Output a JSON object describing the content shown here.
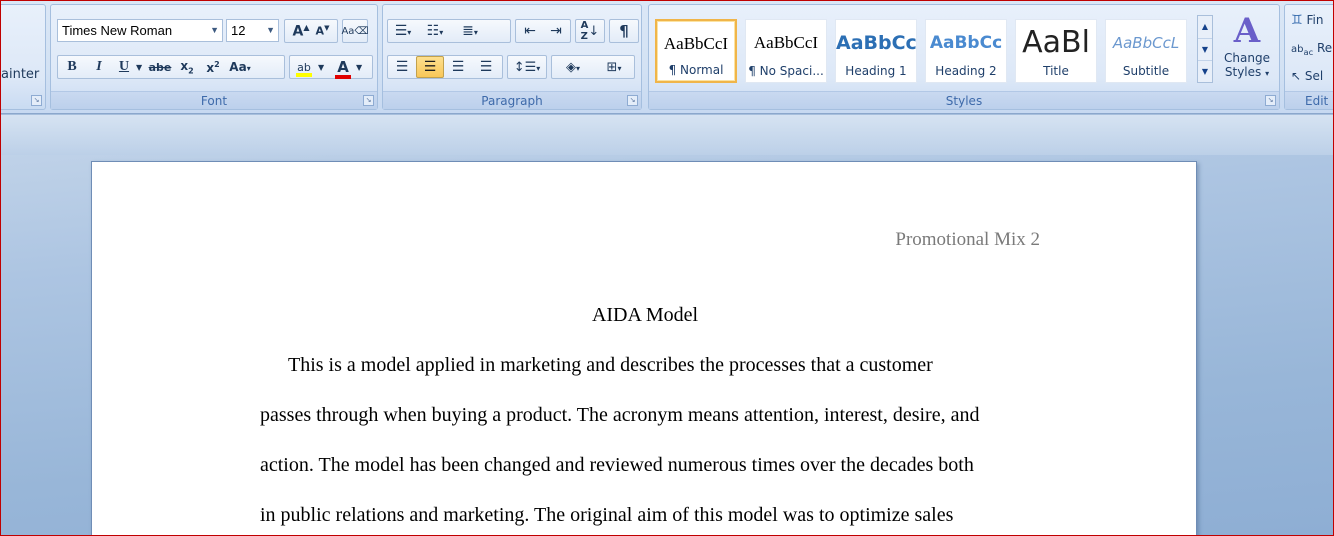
{
  "clipboard": {
    "painter_label": "ainter"
  },
  "font": {
    "group_label": "Font",
    "name": "Times New Roman",
    "size": "12"
  },
  "paragraph": {
    "group_label": "Paragraph"
  },
  "styles": {
    "group_label": "Styles",
    "items": [
      {
        "sample": "AaBbCcI",
        "name": "¶ Normal"
      },
      {
        "sample": "AaBbCcI",
        "name": "¶ No Spaci..."
      },
      {
        "sample": "AaBbCc",
        "name": "Heading 1"
      },
      {
        "sample": "AaBbCc",
        "name": "Heading 2"
      },
      {
        "sample": "AaBl",
        "name": "Title"
      },
      {
        "sample": "AaBbCcL",
        "name": "Subtitle"
      }
    ],
    "change_styles_line1": "Change",
    "change_styles_line2": "Styles"
  },
  "editing": {
    "group_label": "Edit",
    "find_label": "Fin",
    "replace_label": "Re",
    "select_label": "Sel"
  },
  "document": {
    "header": "Promotional Mix 2",
    "title": "AIDA  Model",
    "lines": [
      "This is a model applied in marketing and describes the processes that a customer",
      "passes through when buying a product. The acronym means attention, interest, desire, and",
      "action. The model has been changed and reviewed numerous times over the decades both",
      "in public relations and marketing. The original aim of this model was to optimize sales"
    ]
  }
}
